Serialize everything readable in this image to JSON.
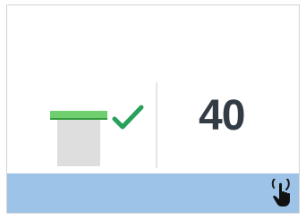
{
  "indicator": {
    "value": "40",
    "status": "ok",
    "status_icon": "check-icon",
    "level_icon": "level-bar-icon"
  },
  "footer": {
    "action_icon": "touch-hand-icon"
  },
  "colors": {
    "accent_green": "#6fcf6f",
    "check_green": "#27a05a",
    "value_text": "#333b44",
    "footer_bg": "#9dc3e8",
    "bar_gray": "#dedede"
  }
}
